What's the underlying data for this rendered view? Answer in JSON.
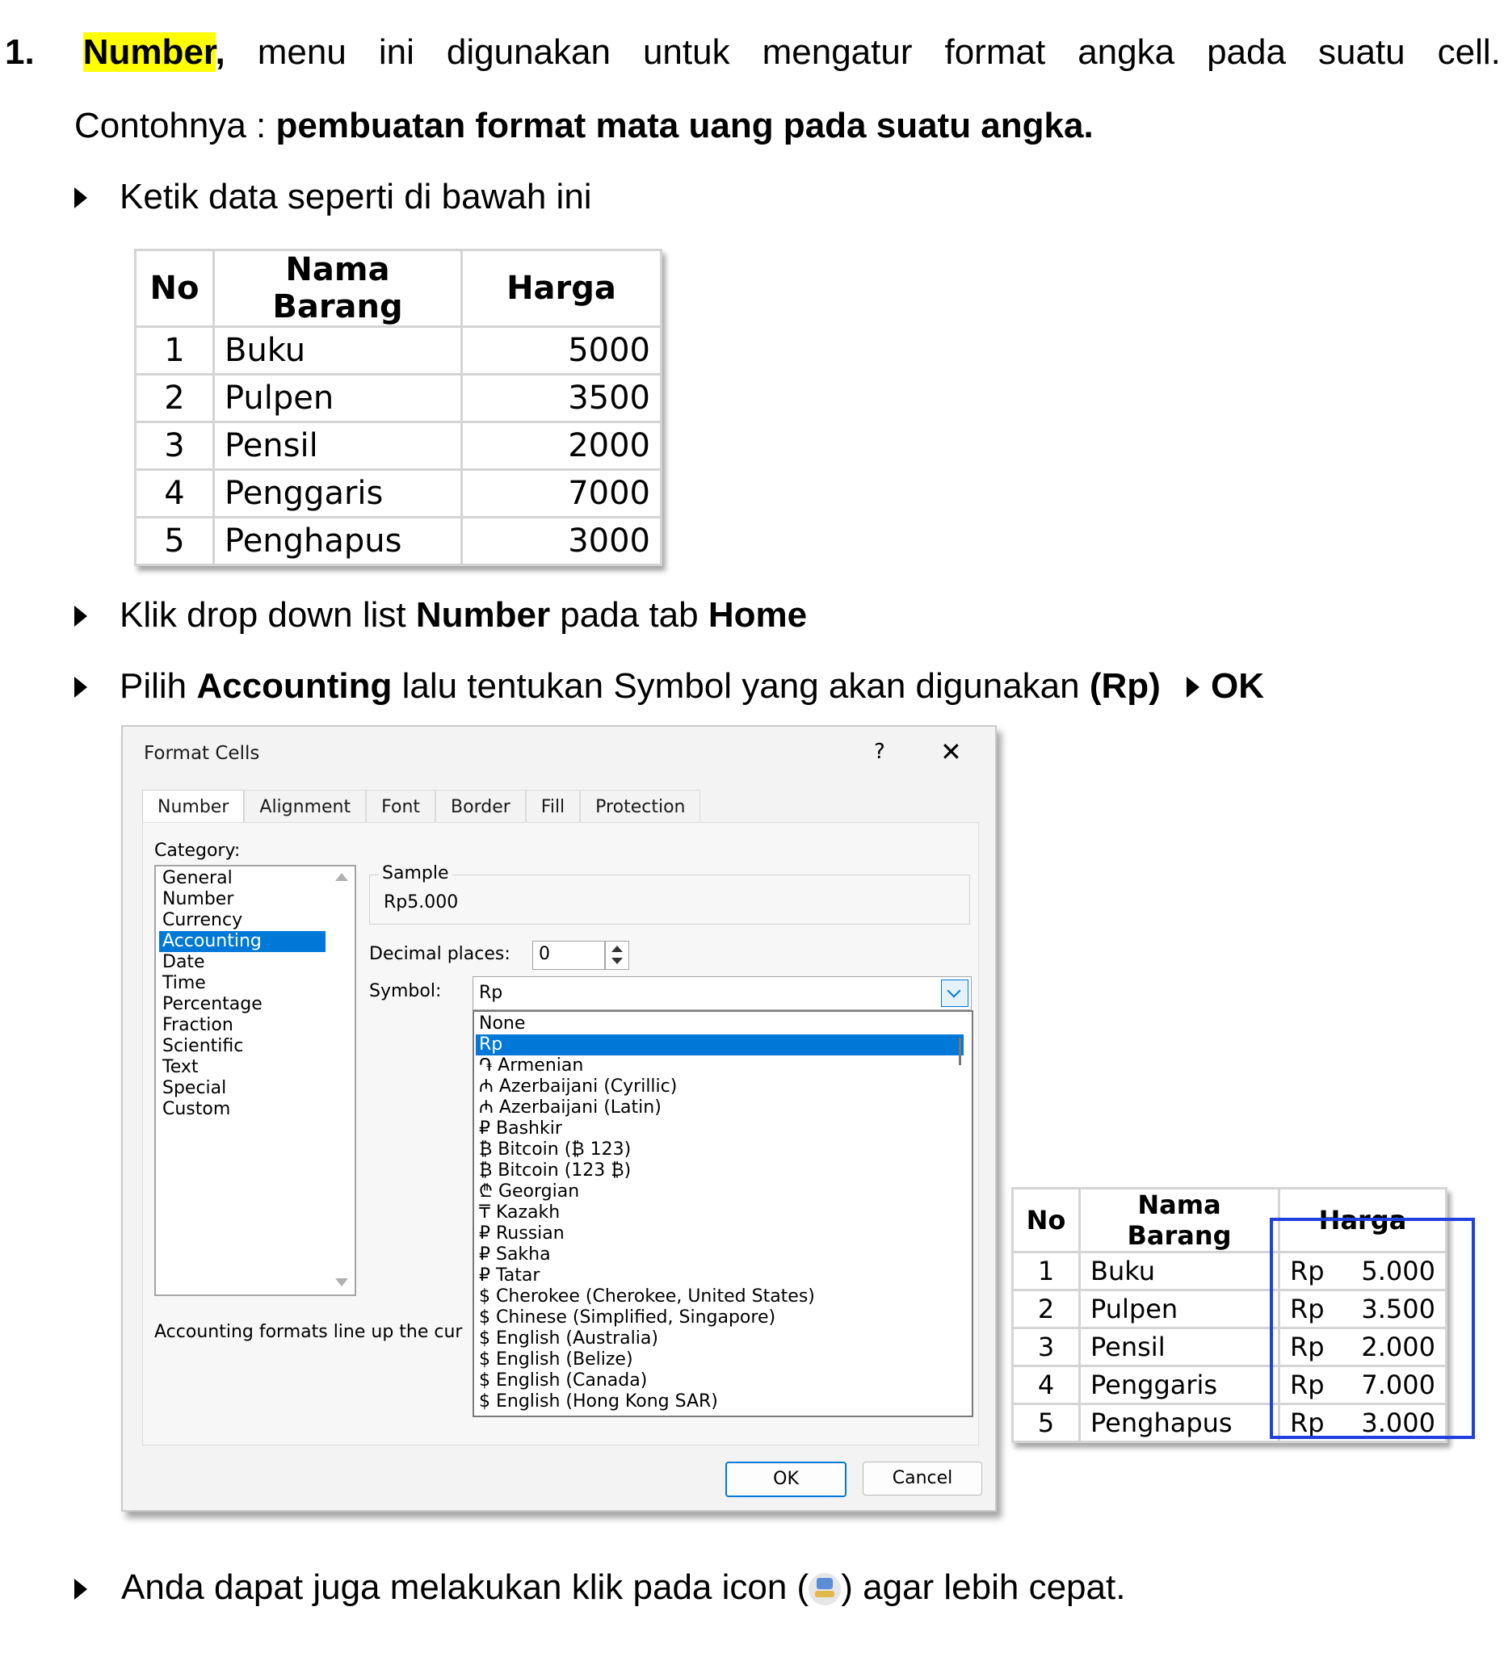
{
  "heading": {
    "number": "1.",
    "keyword": "Number",
    "comma": ",",
    "words": [
      "menu",
      "ini",
      "digunakan",
      "untuk",
      "mengatur",
      "format",
      "angka",
      "pada",
      "suatu",
      "cell."
    ]
  },
  "example": {
    "prefix": "Contohnya : ",
    "bold": "pembuatan format mata uang pada suatu angka."
  },
  "steps": {
    "s1": "Ketik data seperti di bawah ini",
    "s2_a": "Klik drop down list ",
    "s2_b": "Number",
    "s2_c": " pada tab ",
    "s2_d": "Home",
    "s3_a": "Pilih ",
    "s3_b": "Accounting",
    "s3_c": " lalu tentukan Symbol yang akan digunakan ",
    "s3_d": "(Rp)",
    "s3_e": "OK",
    "s4_a": "Anda dapat juga melakukan klik pada icon (",
    "s4_b": ") agar lebih cepat."
  },
  "table1": {
    "headers": [
      "No",
      "Nama Barang",
      "Harga"
    ],
    "rows": [
      [
        "1",
        "Buku",
        "5000"
      ],
      [
        "2",
        "Pulpen",
        "3500"
      ],
      [
        "3",
        "Pensil",
        "2000"
      ],
      [
        "4",
        "Penggaris",
        "7000"
      ],
      [
        "5",
        "Penghapus",
        "3000"
      ]
    ]
  },
  "table2": {
    "headers": [
      "No",
      "Nama Barang",
      "Harga"
    ],
    "rows": [
      [
        "1",
        "Buku",
        "Rp",
        "5.000"
      ],
      [
        "2",
        "Pulpen",
        "Rp",
        "3.500"
      ],
      [
        "3",
        "Pensil",
        "Rp",
        "2.000"
      ],
      [
        "4",
        "Penggaris",
        "Rp",
        "7.000"
      ],
      [
        "5",
        "Penghapus",
        "Rp",
        "3.000"
      ]
    ]
  },
  "dialog": {
    "title": "Format Cells",
    "help": "?",
    "close": "✕",
    "tabs": [
      "Number",
      "Alignment",
      "Font",
      "Border",
      "Fill",
      "Protection"
    ],
    "category_label": "Category:",
    "categories": [
      "General",
      "Number",
      "Currency",
      "Accounting",
      "Date",
      "Time",
      "Percentage",
      "Fraction",
      "Scientific",
      "Text",
      "Special",
      "Custom"
    ],
    "sample_label": "Sample",
    "sample_value": "Rp5.000",
    "decimal_label": "Decimal places:",
    "decimal_value": "0",
    "symbol_label": "Symbol:",
    "symbol_value": "Rp",
    "symbols": [
      "None",
      "Rp",
      "֏ Armenian",
      "₼ Azerbaijani (Cyrillic)",
      "₼ Azerbaijani (Latin)",
      "₽ Bashkir",
      "₿ Bitcoin (₿ 123)",
      "₿ Bitcoin (123 ₿)",
      "₾ Georgian",
      "₸ Kazakh",
      "₽ Russian",
      "₽ Sakha",
      "₽ Tatar",
      "$ Cherokee (Cherokee, United States)",
      "$ Chinese (Simplified, Singapore)",
      "$ English (Australia)",
      "$ English (Belize)",
      "$ English (Canada)",
      "$ English (Hong Kong SAR)"
    ],
    "description": "Accounting formats line up the cur",
    "ok": "OK",
    "cancel": "Cancel"
  },
  "colors": {
    "highlight": "#ffff00",
    "selection": "#0078d7",
    "frame": "#1f3fe0"
  }
}
